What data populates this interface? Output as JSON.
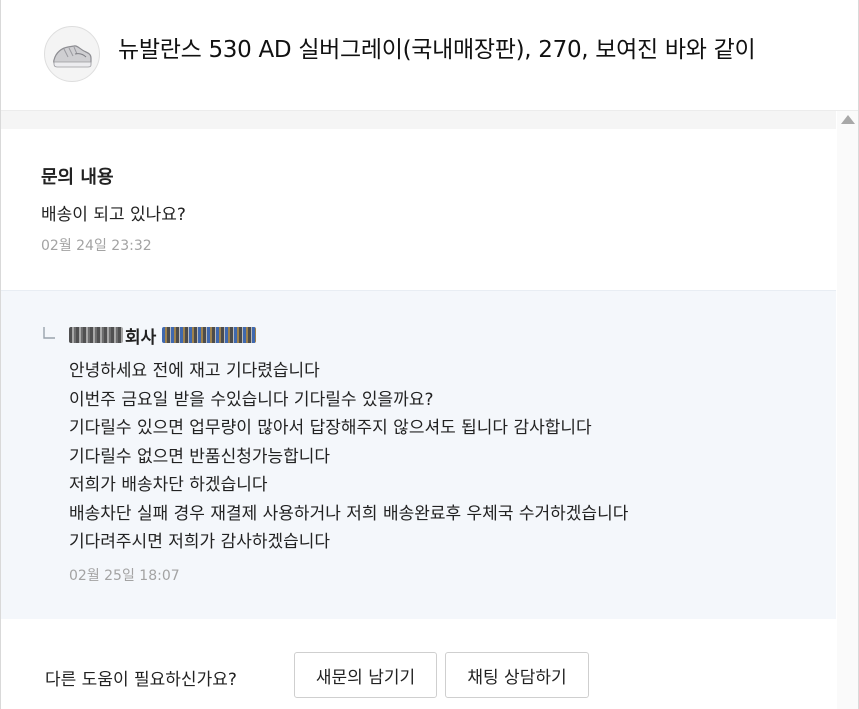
{
  "header": {
    "product_title": "뉴발란스 530 AD 실버그레이(국내매장판), 270, 보여진 바와 같이",
    "thumbnail_icon": "sneaker-icon"
  },
  "question": {
    "label": "문의 내용",
    "text": "배송이 되고 있나요?",
    "date": "02월 24일 23:32"
  },
  "answer": {
    "reply_icon": "reply-arrow-icon",
    "seller_word": "회사",
    "lines": [
      "안녕하세요 전에 재고 기다렸습니다",
      "이번주 금요일 받을 수있습니다 기다릴수 있을까요?",
      "기다릴수 있으면 업무량이 많아서 답장해주지 않으셔도 됩니다 감사합니다",
      "기다릴수 없으면 반품신청가능합니다",
      "저희가 배송차단 하겠습니다",
      "배송차단 실패 경우 재결제 사용하거나 저희 배송완료후 우체국 수거하겠습니다",
      "기다려주시면 저희가 감사하겠습니다"
    ],
    "date": "02월 25일 18:07"
  },
  "footer": {
    "help_label": "다른 도움이 필요하신가요?",
    "new_inquiry_label": "새문의 남기기",
    "chat_label": "채팅 상담하기"
  },
  "colors": {
    "answer_bg": "#f4f7fb",
    "muted_text": "#a3a3a3"
  }
}
